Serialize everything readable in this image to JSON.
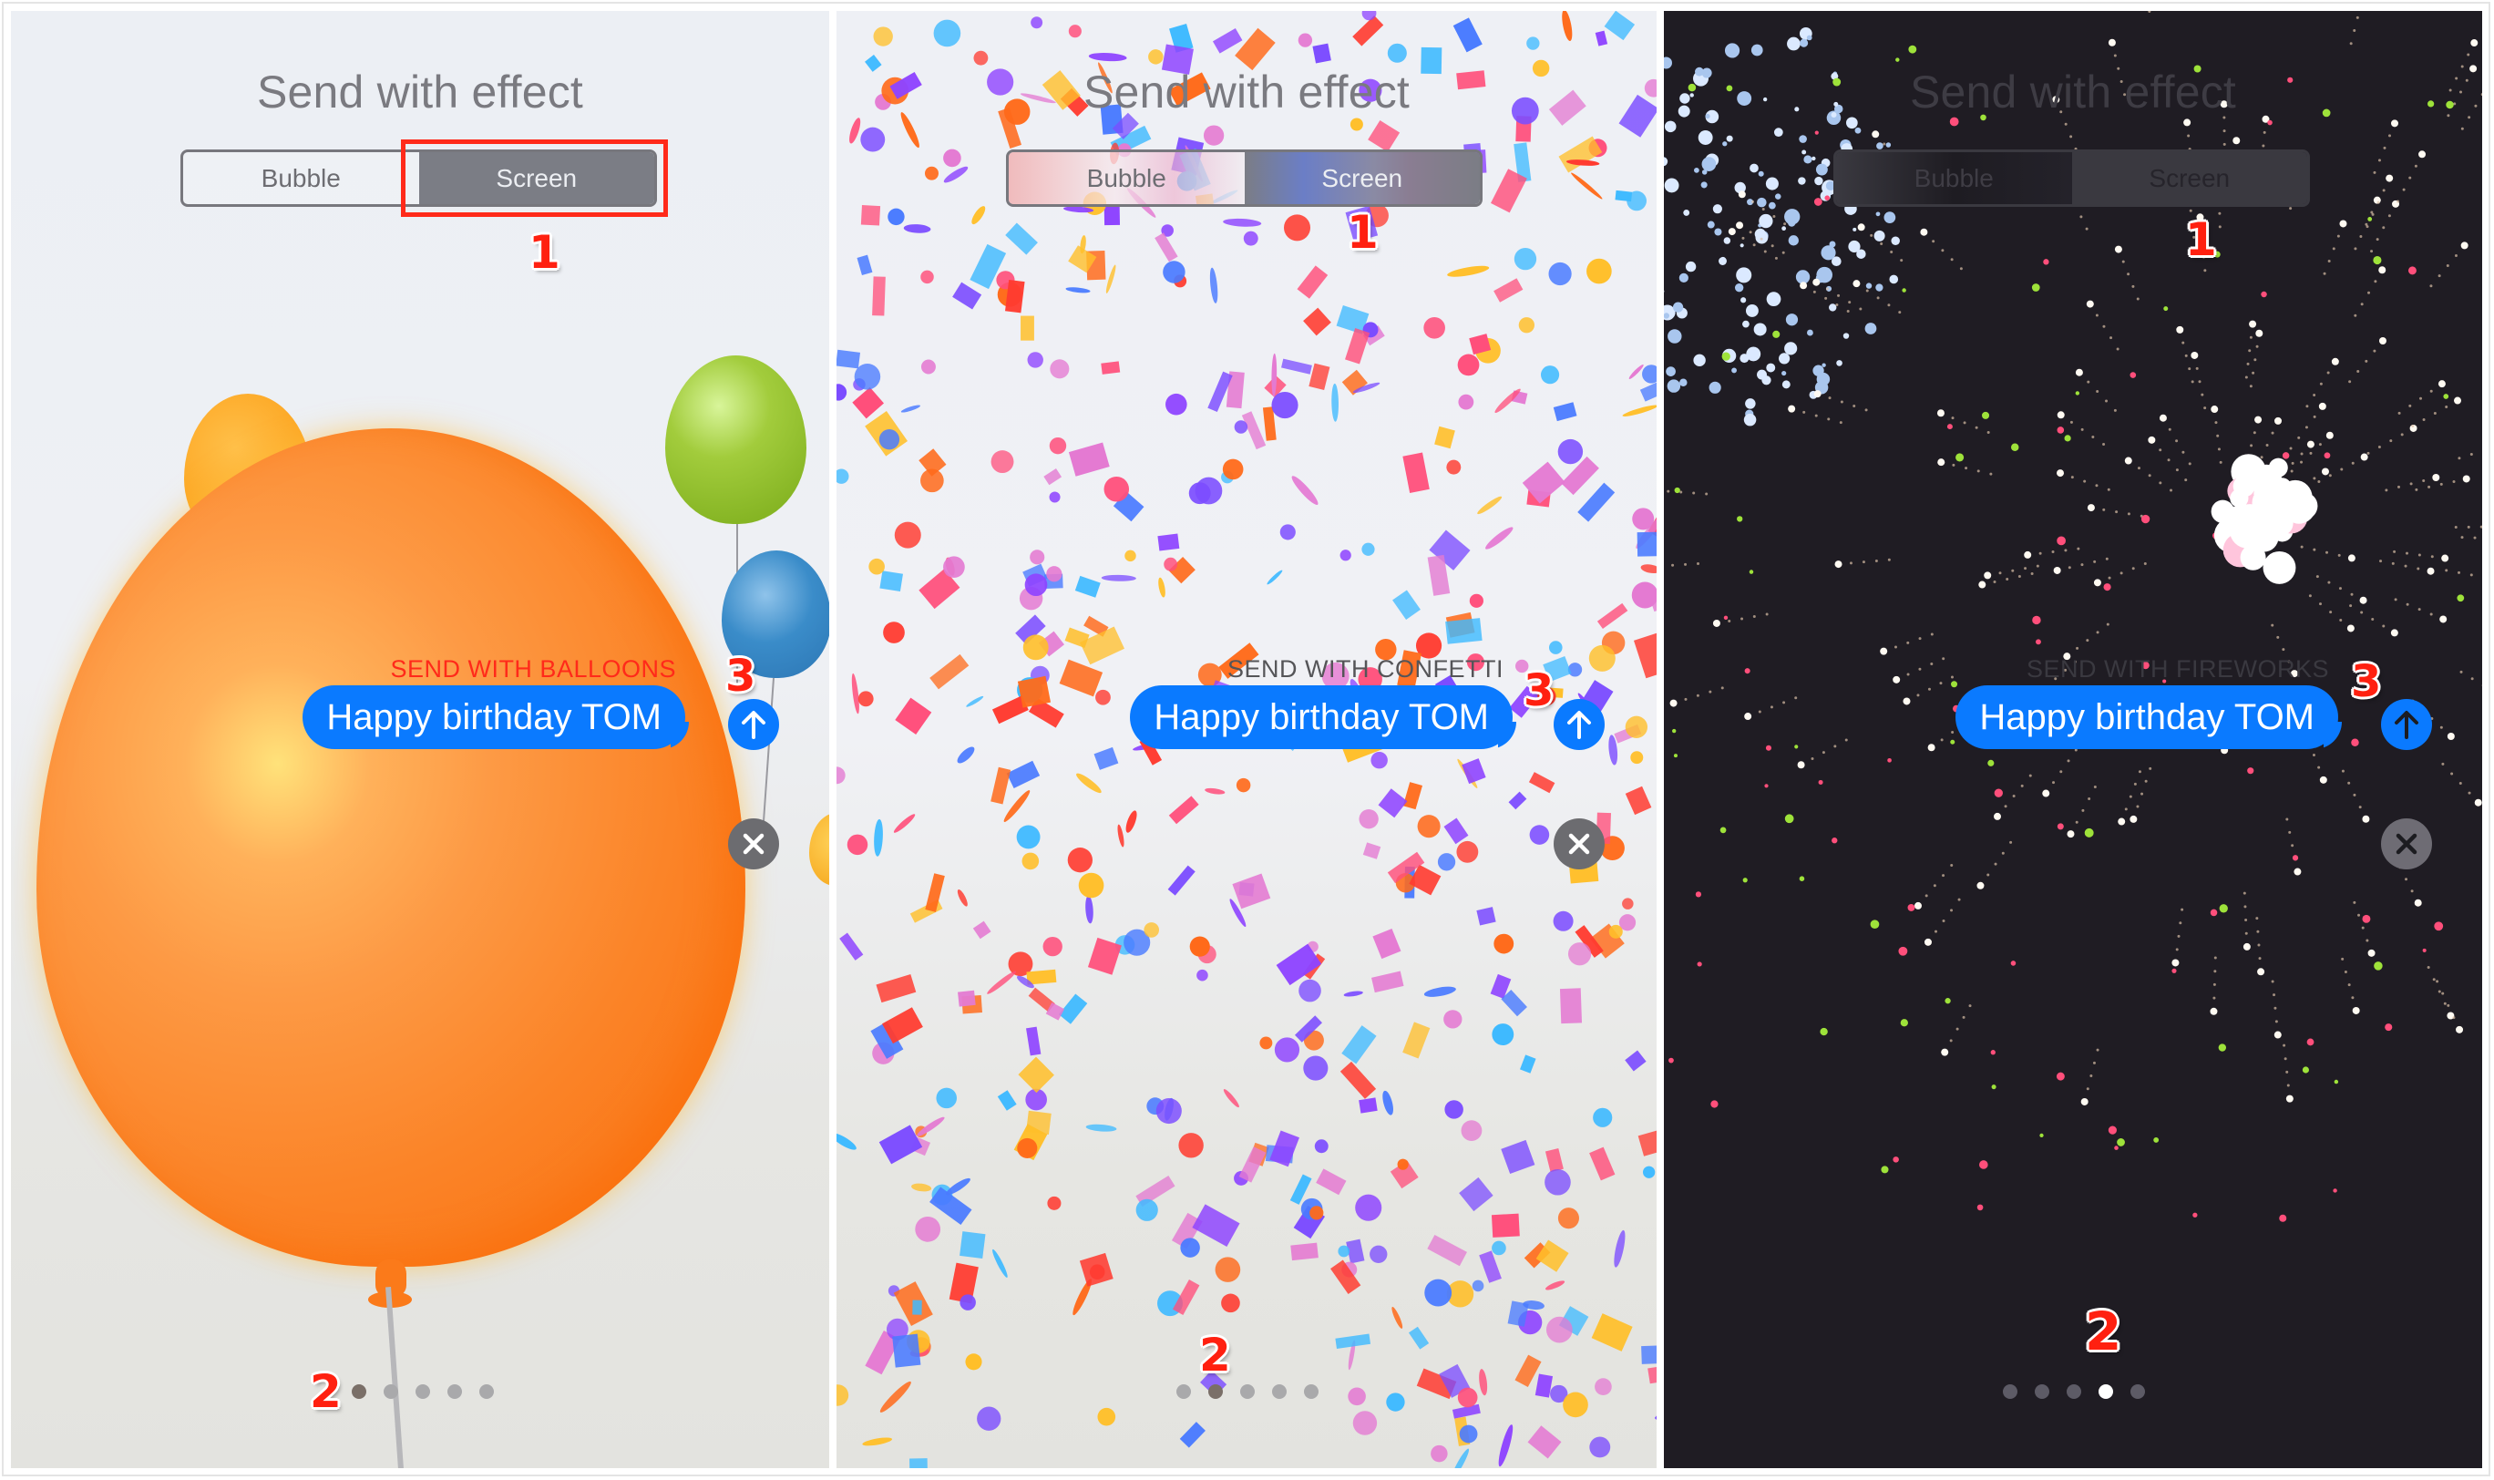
{
  "screen_title": "Send with effect",
  "segmented_control": {
    "options": [
      "Bubble",
      "Screen"
    ],
    "selected": "Screen"
  },
  "annotations": {
    "step1": "1",
    "step2": "2",
    "step3": "3"
  },
  "message": {
    "text": "Happy birthday TOM"
  },
  "panels": [
    {
      "effect_label": "SEND WITH BALLOONS",
      "effect_label_color": "#ff2a1a",
      "page_index": 1,
      "page_count": 5,
      "theme": "light"
    },
    {
      "effect_label": "SEND WITH CONFETTI",
      "effect_label_color": "#555558",
      "page_index": 2,
      "page_count": 5,
      "theme": "light"
    },
    {
      "effect_label": "SEND WITH FIREWORKS",
      "effect_label_color": "#3a3940",
      "page_index": 4,
      "page_count": 5,
      "theme": "dark"
    }
  ],
  "icons": {
    "send": "arrow-up-icon",
    "cancel": "close-x-icon"
  },
  "colors": {
    "imessage_blue": "#0a7aff",
    "annotation_red": "#ff2a1a",
    "dark_bg": "#1f1c23"
  }
}
